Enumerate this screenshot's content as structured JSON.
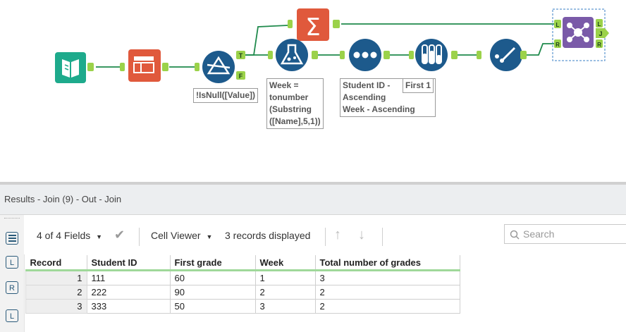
{
  "workflow": {
    "annotations": {
      "filter_expression": "!IsNull([Value])",
      "formula_expression": "Week =\ntonumber\n(Substring\n([Name],5,1))",
      "sort_order": "Student ID -\nAscending\nWeek - Ascending",
      "sample_mode": "First 1"
    },
    "anchors": {
      "filter_true": "T",
      "filter_false": "F",
      "join_left_in": "L",
      "join_right_in": "R",
      "join_left_out": "L",
      "join_inner_out": "J",
      "join_right_out": "R"
    },
    "colors": {
      "connector": "#1f8a4c",
      "anchor": "#9bd24a",
      "selection": "#3a7fc4"
    }
  },
  "results": {
    "title": "Results - Join (9) - Out - Join",
    "toolbar": {
      "fields_label": "4 of 4 Fields",
      "viewer_label": "Cell Viewer",
      "records_label": "3 records displayed",
      "search_placeholder": "Search"
    },
    "sidebar_labels": {
      "left": "L",
      "right": "R",
      "join_left": "L"
    },
    "columns": [
      "Record",
      "Student ID",
      "First grade",
      "Week",
      "Total number of grades"
    ],
    "rows": [
      [
        "1",
        "111",
        "60",
        "1",
        "3"
      ],
      [
        "2",
        "222",
        "90",
        "2",
        "2"
      ],
      [
        "3",
        "333",
        "50",
        "3",
        "2"
      ]
    ]
  }
}
